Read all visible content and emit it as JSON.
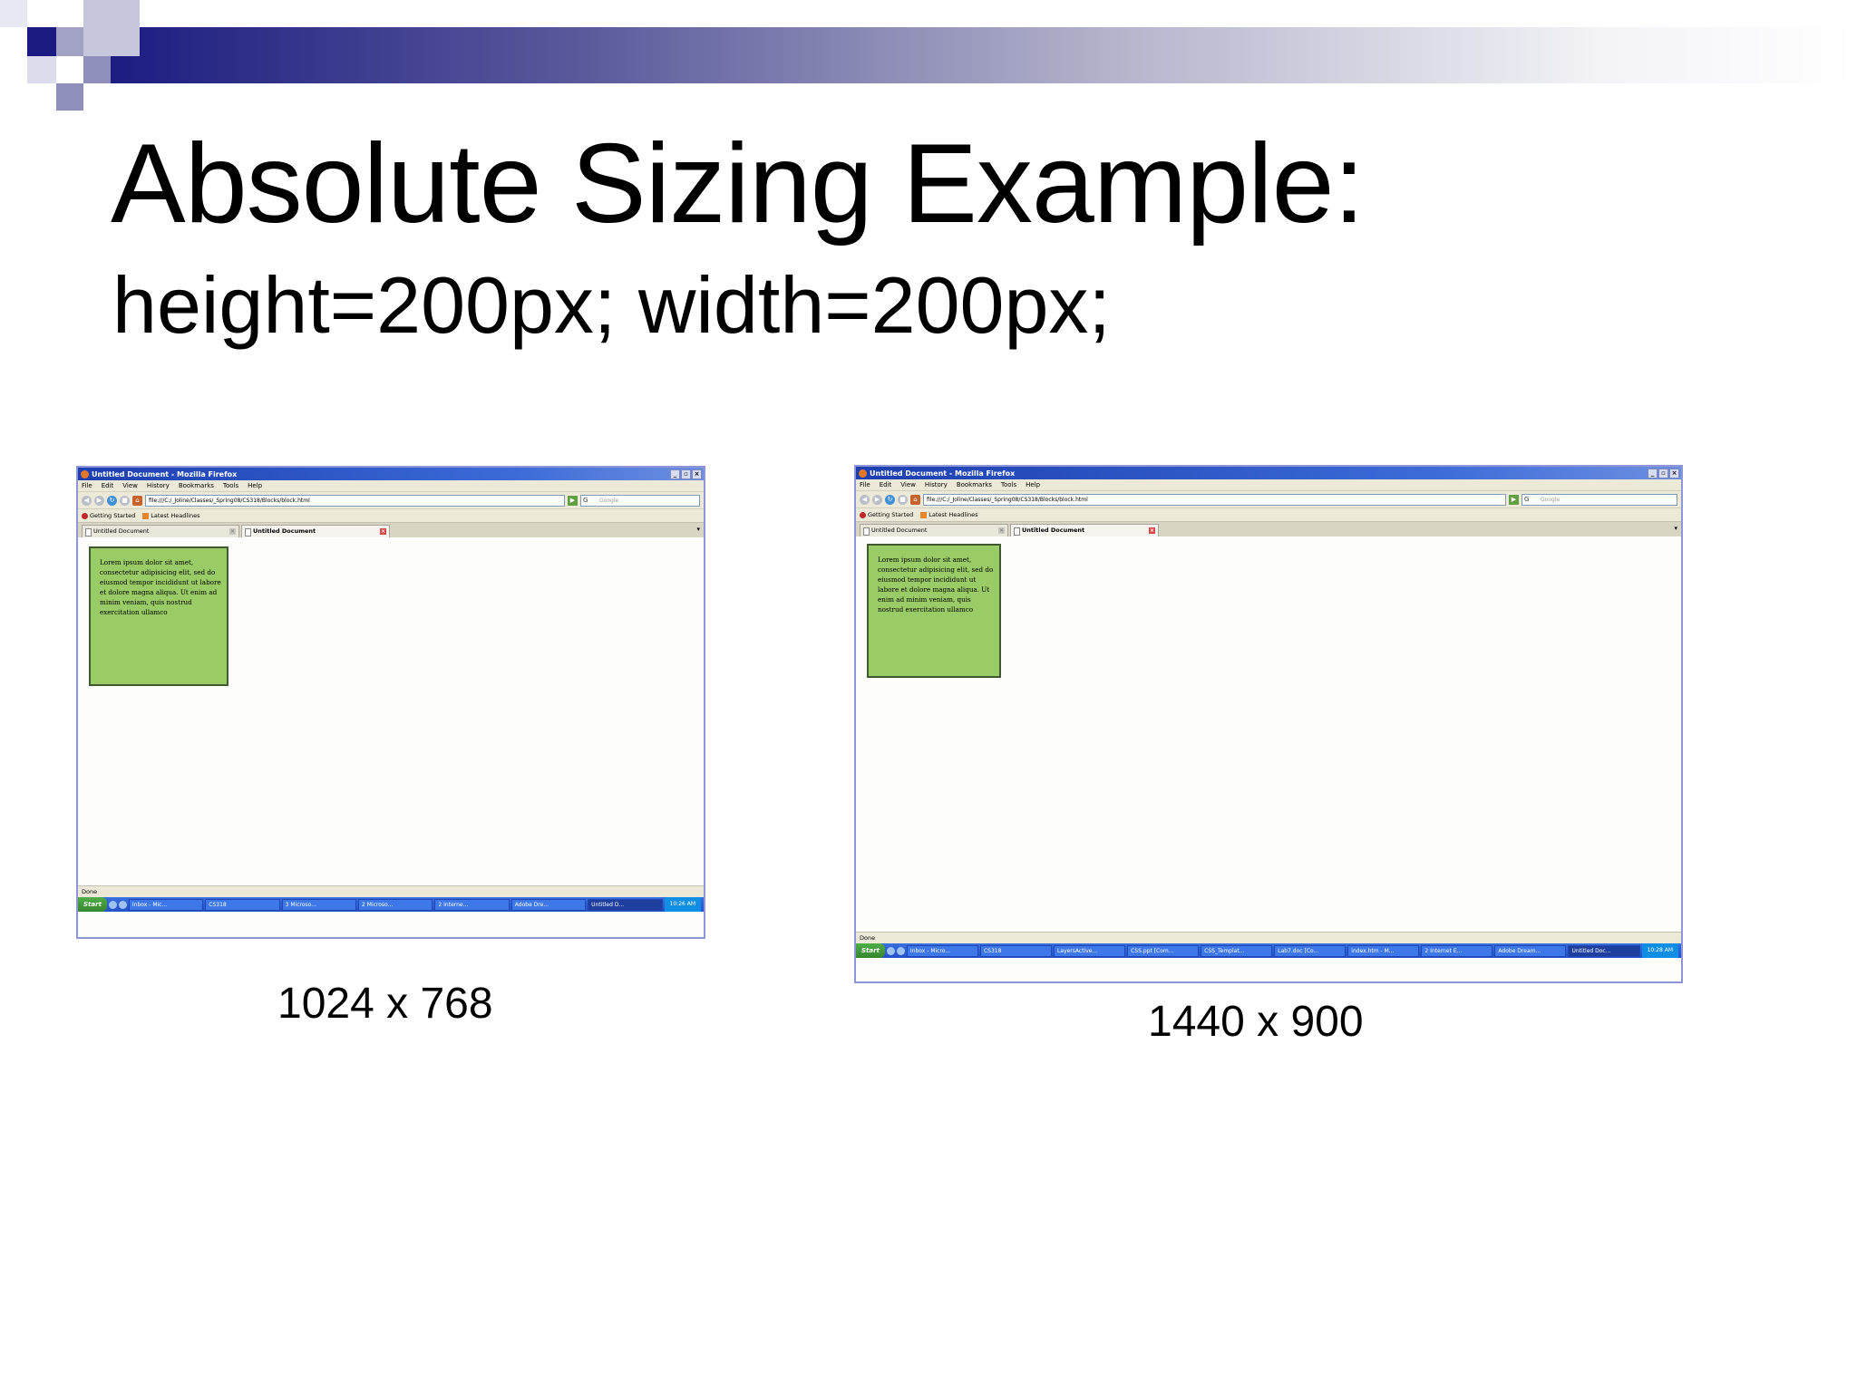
{
  "slide": {
    "title": "Absolute Sizing Example:",
    "subtitle": "height=200px; width=200px;",
    "captions": [
      "1024 x 768",
      "1440 x 900"
    ]
  },
  "browser": {
    "window_title": "Untitled Document - Mozilla Firefox",
    "menu": [
      "File",
      "Edit",
      "View",
      "History",
      "Bookmarks",
      "Tools",
      "Help"
    ],
    "url": "file:///C:/_Joline/Classes/_Spring08/CS318/Blocks/block.html",
    "search_placeholder": "Google",
    "bookmarks": [
      "Getting Started",
      "Latest Headlines"
    ],
    "tabs": [
      "Untitled Document",
      "Untitled Document"
    ],
    "box_text": "Lorem ipsum dolor sit amet, consectetur adipisicing elit, sed do eiusmod tempor incididunt ut labore et dolore magna aliqua. Ut enim ad minim veniam, quis nostrud exercitation ullamco",
    "status": "Done",
    "start_label": "Start"
  },
  "screens": [
    {
      "label": "1024 x 768",
      "taskbar_items": [
        "Inbox - Mic...",
        "CS318",
        "3 Microso...",
        "2 Microso...",
        "2 Interne...",
        "Adobe Dre...",
        "Untitled D..."
      ],
      "clock": "10:26 AM"
    },
    {
      "label": "1440 x 900",
      "taskbar_items": [
        "Inbox - Micro...",
        "CS318",
        "LayersActive...",
        "CSS.ppt [Com...",
        "CSS_Templat...",
        "Lab7.doc [Co...",
        "index.htm - M...",
        "2 Internet E...",
        "Adobe Dream...",
        "Untitled Doc..."
      ],
      "clock": "10:28 AM"
    }
  ],
  "colors": {
    "banner_dark": "#1a1a80",
    "box_fill": "#99cc66",
    "frame_border": "#8e96d8"
  }
}
